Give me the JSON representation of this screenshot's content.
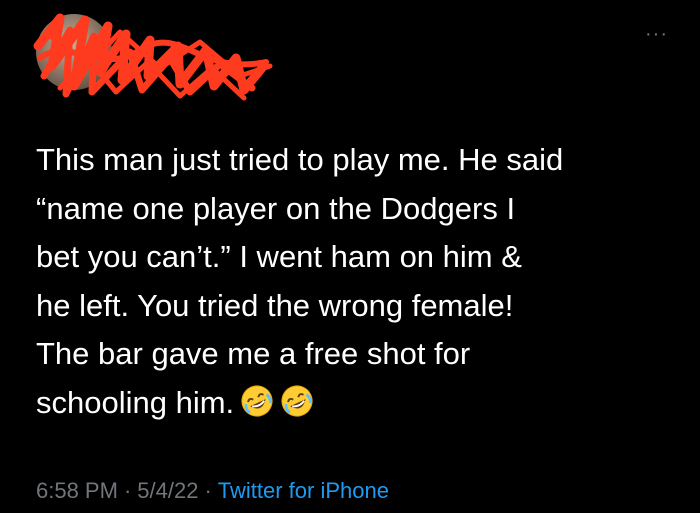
{
  "header": {
    "avatar_icon": "profile-avatar",
    "redaction_color": "#ff3b1f",
    "more_label": "···"
  },
  "tweet": {
    "text": "This man just tried to play me. He said\n“name one player on the Dodgers I\nbet you can’t.” I went ham on him &\nhe left. You tried the wrong female!\nThe bar gave me a free shot for\nschooling him.",
    "emojis": [
      "rolling-on-floor-laughing",
      "rolling-on-floor-laughing"
    ]
  },
  "meta": {
    "time": "6:58 PM",
    "date": "5/4/22",
    "separator": "·",
    "source": "Twitter for iPhone"
  },
  "colors": {
    "background": "#000000",
    "text": "#ffffff",
    "muted": "#71767b",
    "link": "#1d9bf0"
  }
}
